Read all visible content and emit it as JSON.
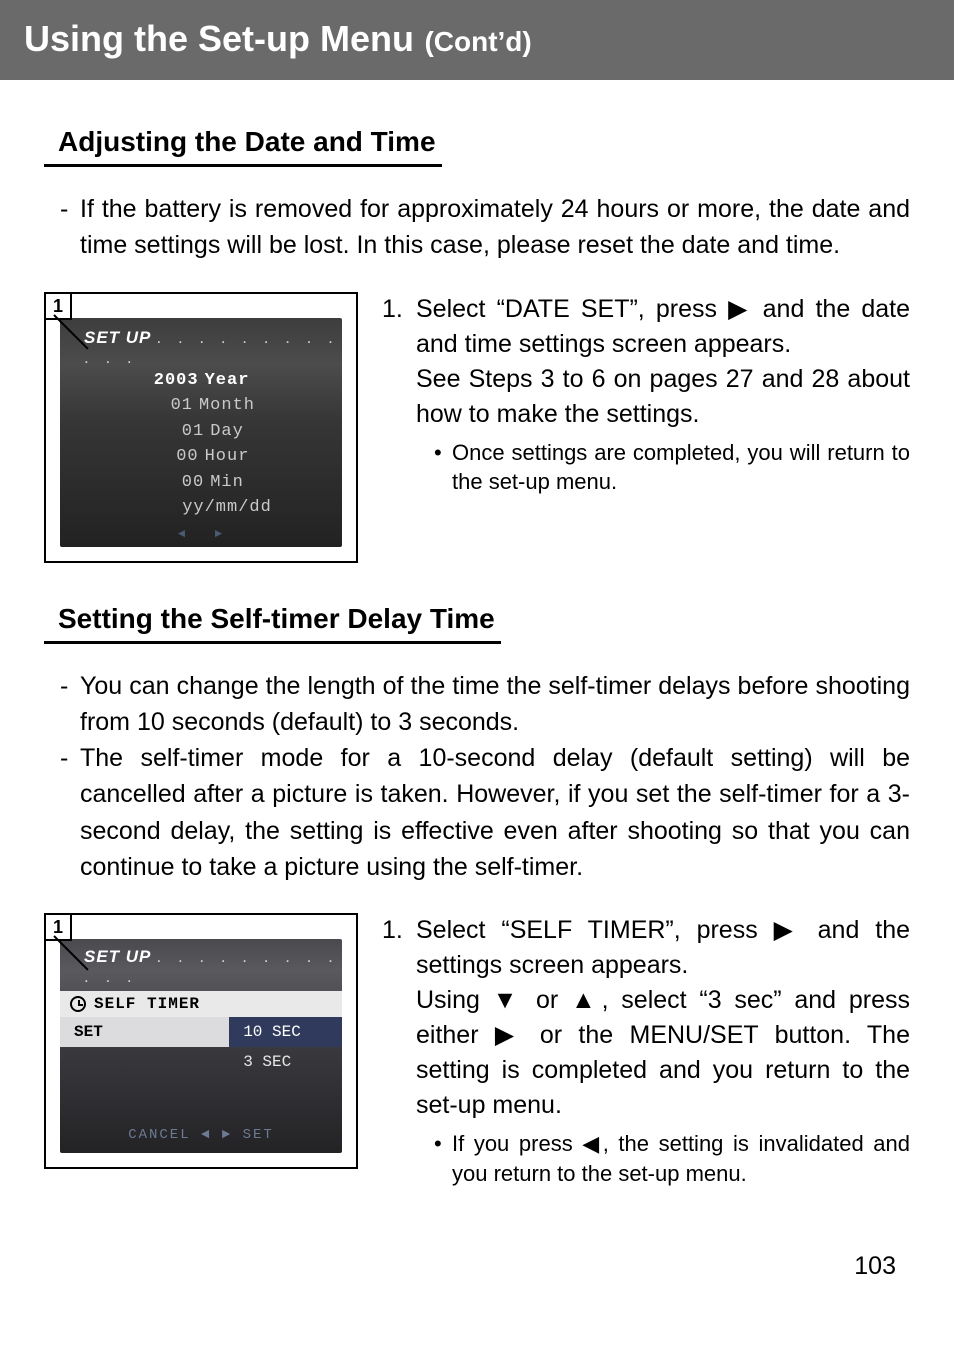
{
  "header": {
    "main": "Using the Set-up Menu",
    "sub": "(Cont’d)"
  },
  "section1": {
    "title": "Adjusting the Date and Time",
    "notes": [
      "If the battery is removed for approximately 24 hours or more, the date and time settings will be lost.  In this case, please reset the date and time."
    ],
    "lcd": {
      "badge": "1",
      "title": "SET UP",
      "dots": ". . . . . . . . . . . .",
      "rows": [
        {
          "value": "2003",
          "unit": "Year",
          "hi": true
        },
        {
          "value": "01",
          "unit": "Month",
          "hi": false
        },
        {
          "value": "01",
          "unit": "Day",
          "hi": false
        },
        {
          "value": "00",
          "unit": "Hour",
          "hi": false
        },
        {
          "value": "00",
          "unit": "Min",
          "hi": false
        },
        {
          "value": "",
          "unit": "yy/mm/dd",
          "hi": false
        }
      ],
      "foot_left": "◄",
      "foot_right": "►"
    },
    "step": {
      "num": "1.",
      "line1": "Select “DATE SET”, press ▶ and the date and time settings screen appears.",
      "line2": "See Steps 3 to 6 on pages 27 and 28 about how to make the settings.",
      "bullets": [
        "Once settings are completed, you will return to the set-up menu."
      ]
    }
  },
  "section2": {
    "title": "Setting the Self-timer Delay Time",
    "notes": [
      "You can change the length of the time the self-timer delays before shooting from 10 seconds (default) to 3 seconds.",
      "The self-timer mode for a 10-second delay (default setting) will be cancelled after a picture is taken. However, if you set the self-timer for a 3-second delay, the setting is effective even after shooting so that you can continue to take a picture using the self-timer."
    ],
    "lcd": {
      "badge": "1",
      "title": "SET UP",
      "dots": ". . . . . . . . . . . .",
      "subtitle": "SELF TIMER",
      "row1_left": "SET",
      "row1_right": "10 SEC",
      "row2_right": "3 SEC",
      "foot": "CANCEL ◄   ► SET"
    },
    "step": {
      "num": "1.",
      "line1": "Select “SELF TIMER”, press ▶ and the settings screen appears.",
      "line2": "Using ▼ or ▲, select “3 sec” and press either ▶ or the MENU/SET button. The setting is completed and you return to the set-up menu.",
      "bullets": [
        "If you press ◀, the setting is invalidated and you return to the set-up menu."
      ]
    }
  },
  "page_number": "103"
}
